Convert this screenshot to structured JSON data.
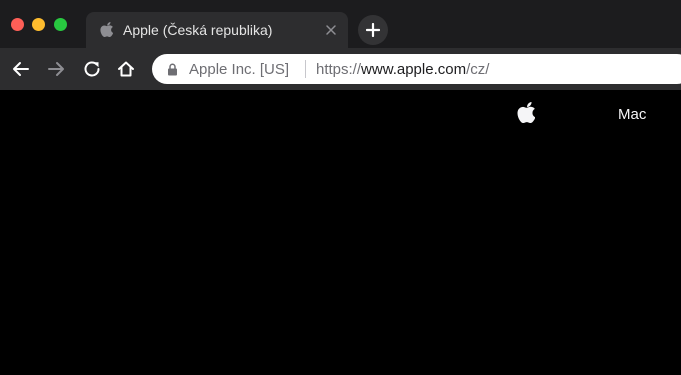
{
  "browser": {
    "tab": {
      "title": "Apple (Česká republika)",
      "favicon": "apple-logo-icon"
    },
    "new_tab_icon": "plus-icon",
    "toolbar": {
      "back_icon": "arrow-left-icon",
      "forward_icon": "arrow-right-icon",
      "reload_icon": "reload-icon",
      "home_icon": "home-icon"
    },
    "address_bar": {
      "security_icon": "lock-icon",
      "organization": "Apple Inc. [US]",
      "url_scheme": "https://",
      "url_host": "www.apple.com",
      "url_path": "/cz/"
    }
  },
  "page": {
    "globalnav": {
      "logo_icon": "apple-logo-icon",
      "items": [
        {
          "label": "Mac"
        }
      ]
    }
  },
  "colors": {
    "tabstrip_bg": "#1c1c1e",
    "toolbar_bg": "#2d2d2f",
    "page_bg": "#000000",
    "traffic_red": "#fe5f57",
    "traffic_yellow": "#febc2e",
    "traffic_green": "#28c840"
  }
}
